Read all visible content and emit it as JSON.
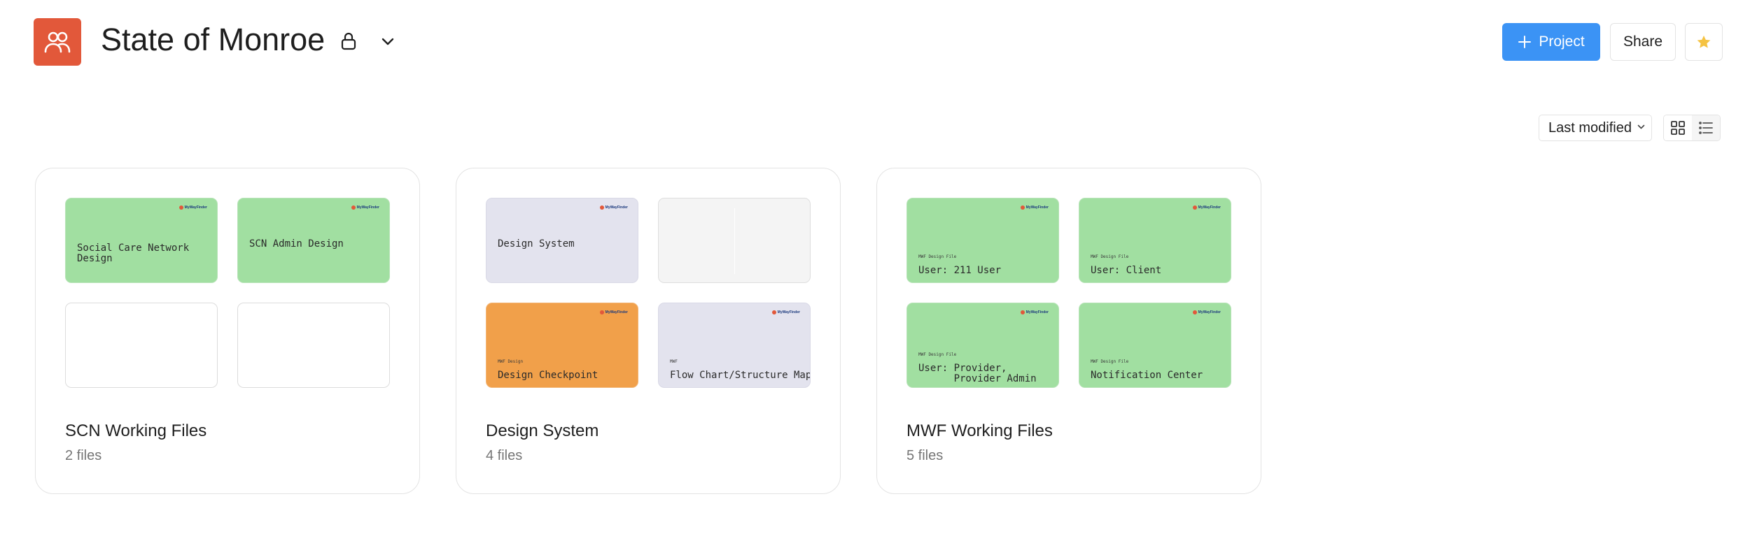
{
  "header": {
    "title": "State of Monroe",
    "new_project_label": "Project",
    "share_label": "Share"
  },
  "toolbar": {
    "sort_label": "Last modified"
  },
  "colors": {
    "avatar": "#e2583a",
    "primary": "#3b93f5",
    "green_thumb": "#a1dfa1",
    "lavender_thumb": "#e3e3ee",
    "orange_thumb": "#f1a04a",
    "star": "#f5c342"
  },
  "brand_text": "MyWayFinder",
  "projects": [
    {
      "name": "SCN Working Files",
      "count": "2 files",
      "thumbs": [
        {
          "style": "green",
          "small": "",
          "title": "Social Care Network\nDesign"
        },
        {
          "style": "green",
          "small": "",
          "title": "SCN Admin Design"
        },
        {
          "style": "blank",
          "small": "",
          "title": ""
        },
        {
          "style": "blank",
          "small": "",
          "title": ""
        }
      ]
    },
    {
      "name": "Design System",
      "count": "4 files",
      "thumbs": [
        {
          "style": "lavender",
          "small": "",
          "title": "Design System"
        },
        {
          "style": "grey",
          "small": "",
          "title": ""
        },
        {
          "style": "orange",
          "small": "MWF Design",
          "title": "Design Checkpoint"
        },
        {
          "style": "lavender",
          "small": "MWF",
          "title": "Flow Chart/Structure Map"
        }
      ]
    },
    {
      "name": "MWF Working Files",
      "count": "5 files",
      "thumbs": [
        {
          "style": "green",
          "small": "MWF Design File",
          "title": "User: 211 User"
        },
        {
          "style": "green",
          "small": "MWF Design File",
          "title": "User: Client"
        },
        {
          "style": "green",
          "small": "MWF Design File",
          "title": "User: Provider,\n      Provider Admin"
        },
        {
          "style": "green",
          "small": "MWF Design File",
          "title": "Notification Center"
        }
      ]
    }
  ]
}
